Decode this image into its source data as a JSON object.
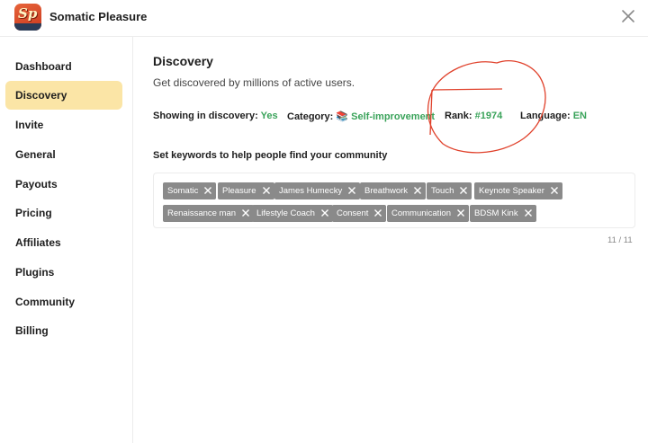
{
  "header": {
    "app_name": "Somatic Pleasure",
    "logo_text": "Sp"
  },
  "sidebar": {
    "items": [
      {
        "label": "Dashboard"
      },
      {
        "label": "Discovery"
      },
      {
        "label": "Invite"
      },
      {
        "label": "General"
      },
      {
        "label": "Payouts"
      },
      {
        "label": "Pricing"
      },
      {
        "label": "Affiliates"
      },
      {
        "label": "Plugins"
      },
      {
        "label": "Community"
      },
      {
        "label": "Billing"
      }
    ],
    "active": "Discovery"
  },
  "discovery": {
    "title": "Discovery",
    "subtitle": "Get discovered by millions of active users.",
    "showing_label": "Showing in discovery:",
    "showing_value": "Yes",
    "category_label": "Category:",
    "category_value": "📚 Self-improvement",
    "rank_label": "Rank:",
    "rank_value": "#1974",
    "language_label": "Language:",
    "language_value": "EN"
  },
  "keywords": {
    "label": "Set keywords to help people find your community",
    "tags": [
      "Somatic",
      "Pleasure",
      "James Humecky",
      "Breathwork",
      "Touch",
      "Keynote Speaker",
      "Renaissance man",
      "Lifestyle Coach",
      "Consent",
      "Communication",
      "BDSM Kink"
    ],
    "counter": "11 / 11"
  },
  "colors": {
    "accent_green": "#3aa35a",
    "active_nav": "#fbe5a6",
    "tag_bg": "#8a8a8a",
    "annotation_red": "#e0412b"
  }
}
